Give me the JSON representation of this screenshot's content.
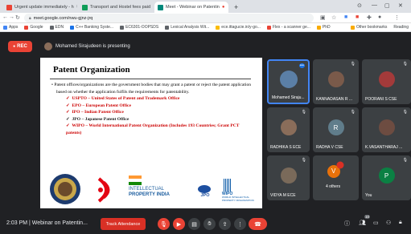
{
  "browser": {
    "tabs": [
      {
        "label": "Urgent update immediately - h",
        "color": "#ea4335"
      },
      {
        "label": "Transport and Hostel fees paid",
        "color": "#0f9d58"
      },
      {
        "label": "Meet - Webinar on Patentin",
        "color": "#00897b"
      }
    ],
    "new_tab": "+",
    "url": "meet.google.com/nwu-gjnz-jrq",
    "bookmarks": [
      "Apps",
      "Google",
      "EDN",
      "C++ Banking Syste...",
      "EC6301-OOPSDS",
      "Lexical Analysis Wit...",
      "ece.ittagucie.in/y-go...",
      "Flex - a scanner ge...",
      "PhD"
    ],
    "other_bookmarks": "Other bookmarks",
    "reading": "Reading"
  },
  "meet": {
    "rec_label": "REC",
    "presenter": "Mohamed Sirajudeen is presenting",
    "slide": {
      "title": "Patent Organization",
      "bullet": "Patent offices/organizations are the government bodies that may grant a patent or reject the patent application based on whether the application fulfils the requirements for patentability.",
      "items": [
        "USPTO – United States of Patent and Trademark Office",
        "EPO – European Patent Office",
        "IPO – Indian Patent Office",
        "JPO – Japanese Patent Office",
        "WIPO – World International Patent Organization (Includes 193 Countries; Grant PCT patents)"
      ],
      "logo_ipo_line1": "INTELLECTUAL",
      "logo_ipo_line2": "PROPERTY INDIA",
      "logo_jpo": "JPO",
      "logo_wipo_line1": "WIPO",
      "logo_wipo_line2": "WORLD INTELLECTUAL PROPERTY ORGANIZATION"
    },
    "participants": [
      {
        "name": "Mohamed Siraju...",
        "initial": "",
        "color": "#5b7fa6"
      },
      {
        "name": "KANNADASAN R ...",
        "initial": "",
        "color": "#7a5a4a"
      },
      {
        "name": "POORANI S CSE",
        "initial": "",
        "color": "#a33a3a"
      },
      {
        "name": "RADHIKA S ECE",
        "initial": "",
        "color": "#8a6d5a"
      },
      {
        "name": "RADHA V CSE",
        "initial": "R",
        "color": "#607d8b"
      },
      {
        "name": "K.VASANTHARAJ ...",
        "initial": "",
        "color": "#6d4c41"
      },
      {
        "name": "VIDYA M ECE",
        "initial": "",
        "color": "#7a6a5a"
      },
      {
        "name": "4 others",
        "initial": "V",
        "color": "#e8710a"
      },
      {
        "name": "You",
        "initial": "P",
        "color": "#0b8043"
      }
    ]
  },
  "bottom": {
    "clock": "2:03 PM | Webinar on Patentin...",
    "track_attendance": "Track Attendance",
    "participant_count": "10"
  }
}
